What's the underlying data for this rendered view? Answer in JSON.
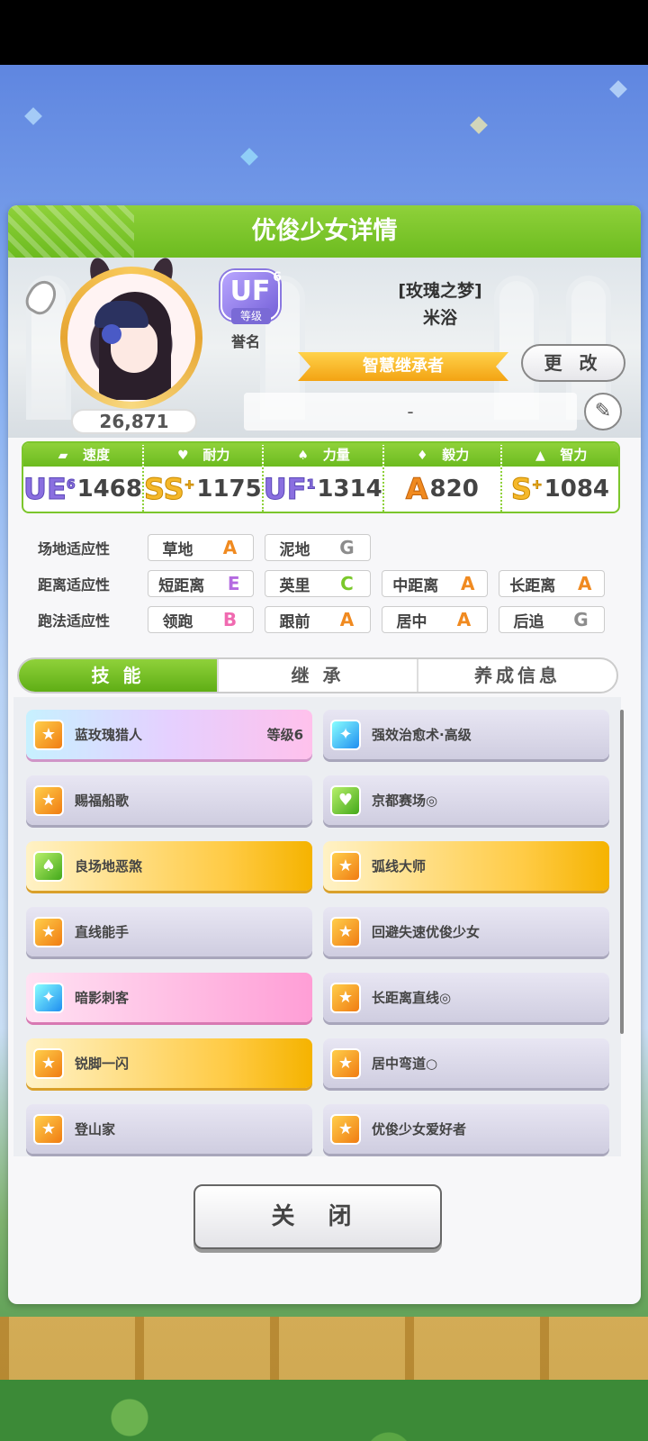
{
  "header": {
    "title": "优俊少女详情"
  },
  "profile": {
    "fan_count": "26,871",
    "rank": {
      "grade": "UF",
      "sup": "6",
      "level_label": "等级"
    },
    "rank_caption": "誉名",
    "title_tag": "[玫瑰之梦]",
    "name": "米浴",
    "epithet": "智慧继承者",
    "change_label": "更 改",
    "comment": "-"
  },
  "stats": [
    {
      "label": "速度",
      "grade": "UE",
      "sup": "6",
      "value": "1468",
      "icon": "shoe-icon"
    },
    {
      "label": "耐力",
      "grade": "SS",
      "sup": "+",
      "value": "1175",
      "icon": "heart-icon"
    },
    {
      "label": "力量",
      "grade": "UF",
      "sup": "1",
      "value": "1314",
      "icon": "arm-icon"
    },
    {
      "label": "毅力",
      "grade": "A",
      "sup": "",
      "value": "820",
      "icon": "flame-icon"
    },
    {
      "label": "智力",
      "grade": "S",
      "sup": "+",
      "value": "1084",
      "icon": "mortarboard-icon"
    }
  ],
  "aptitude": {
    "track_label": "场地适应性",
    "distance_label": "距离适应性",
    "style_label": "跑法适应性",
    "track": [
      {
        "name": "草地",
        "grade": "A"
      },
      {
        "name": "泥地",
        "grade": "G"
      }
    ],
    "distance": [
      {
        "name": "短距离",
        "grade": "E"
      },
      {
        "name": "英里",
        "grade": "C"
      },
      {
        "name": "中距离",
        "grade": "A"
      },
      {
        "name": "长距离",
        "grade": "A"
      }
    ],
    "style": [
      {
        "name": "领跑",
        "grade": "B"
      },
      {
        "name": "跟前",
        "grade": "A"
      },
      {
        "name": "居中",
        "grade": "A"
      },
      {
        "name": "后追",
        "grade": "G"
      }
    ]
  },
  "tabs": [
    {
      "label": "技 能"
    },
    {
      "label": "继 承"
    },
    {
      "label": "养成信息"
    }
  ],
  "skills": [
    {
      "name": "蓝玫瑰猎人",
      "level": "等级6"
    },
    {
      "name": "强效治愈术·高级"
    },
    {
      "name": "赐福船歌"
    },
    {
      "name": "京都赛场◎"
    },
    {
      "name": "良场地恶煞"
    },
    {
      "name": "弧线大师"
    },
    {
      "name": "直线能手"
    },
    {
      "name": "回避失速优俊少女"
    },
    {
      "name": "暗影刺客"
    },
    {
      "name": "长距离直线◎"
    },
    {
      "name": "锐脚一闪"
    },
    {
      "name": "居中弯道○"
    },
    {
      "name": "登山家"
    },
    {
      "name": "优俊少女爱好者"
    }
  ],
  "close_label": "关 闭"
}
